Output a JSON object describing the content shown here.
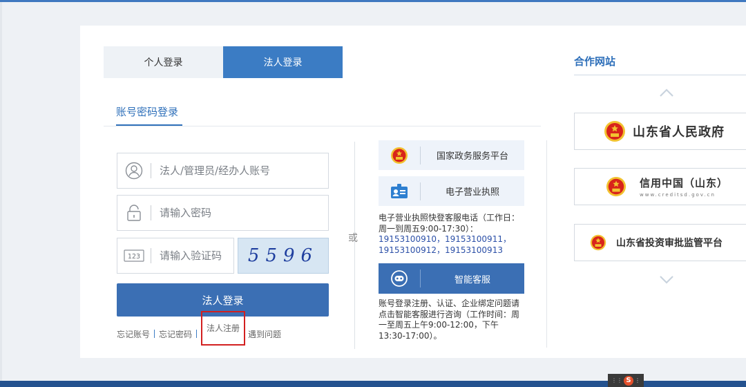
{
  "tabs": {
    "personal": "个人登录",
    "corporate": "法人登录"
  },
  "login": {
    "section_title": "账号密码登录",
    "account_placeholder": "法人/管理员/经办人账号",
    "password_placeholder": "请输入密码",
    "code_placeholder": "请输入验证码",
    "captcha_text": "5596",
    "submit_label": "法人登录",
    "links": {
      "forgot_account": "忘记账号",
      "forgot_password": "忘记密码",
      "register": "法人注册",
      "problems": "遇到问题"
    }
  },
  "separator": "或",
  "services": {
    "gov_platform": "国家政务服务平台",
    "e_license": "电子营业执照",
    "e_license_info": "电子营业执照快登客服电话（工作日：周一到周五9:00-17:30）：",
    "phones": "19153100910，19153100911，19153100912，19153100913",
    "smart_service": "智能客服",
    "smart_service_info": "账号登录注册、认证、企业绑定问题请点击智能客服进行咨询（工作时间：周一至周五上午9:00-12:00，下午13:30-17:00）。"
  },
  "partners": {
    "title": "合作网站",
    "sites": [
      {
        "name": "山东省人民政府"
      },
      {
        "name": "信用中国（山东）",
        "url": "www.creditsd.gov.cn"
      },
      {
        "name": "山东省投资审批监管平台"
      }
    ]
  },
  "colors": {
    "primary": "#3b7cc4",
    "button": "#3b6fb4",
    "highlight_box": "#d21f1f",
    "emblem_red": "#d8241b",
    "emblem_gold": "#f2c230"
  },
  "icons": {
    "account": "user-icon",
    "password": "lock-icon",
    "code": "number-123-icon",
    "gov": "national-emblem-icon",
    "license": "id-badge-icon",
    "service": "chat-robot-icon",
    "up": "chevron-up-icon",
    "down": "chevron-down-icon"
  }
}
